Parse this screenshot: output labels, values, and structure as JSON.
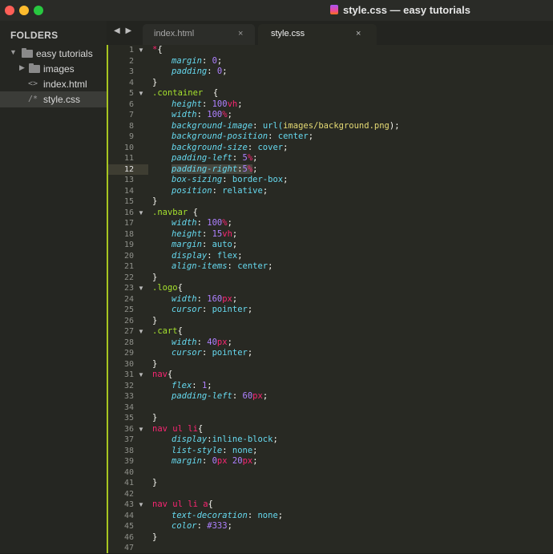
{
  "window": {
    "title": "style.css — easy tutorials"
  },
  "sidebar": {
    "header": "FOLDERS",
    "root": "easy tutorials",
    "items": [
      {
        "label": "images",
        "icon": "folder-icon"
      },
      {
        "label": "index.html",
        "icon": "html-file-icon"
      },
      {
        "label": "style.css",
        "icon": "css-file-icon"
      }
    ]
  },
  "tabs": [
    {
      "label": "index.html",
      "close": "×"
    },
    {
      "label": "style.css",
      "close": "×"
    }
  ],
  "nav_arrows": "◀ ▶",
  "editor": {
    "current_line": 12,
    "lines": [
      {
        "n": "1"
      },
      {
        "n": "2"
      },
      {
        "n": "3"
      },
      {
        "n": "4"
      },
      {
        "n": "5"
      },
      {
        "n": "6"
      },
      {
        "n": "7"
      },
      {
        "n": "8"
      },
      {
        "n": "9"
      },
      {
        "n": "10"
      },
      {
        "n": "11"
      },
      {
        "n": "12"
      },
      {
        "n": "13"
      },
      {
        "n": "14"
      },
      {
        "n": "15"
      },
      {
        "n": "16"
      },
      {
        "n": "17"
      },
      {
        "n": "18"
      },
      {
        "n": "19"
      },
      {
        "n": "20"
      },
      {
        "n": "21"
      },
      {
        "n": "22"
      },
      {
        "n": "23"
      },
      {
        "n": "24"
      },
      {
        "n": "25"
      },
      {
        "n": "26"
      },
      {
        "n": "27"
      },
      {
        "n": "28"
      },
      {
        "n": "29"
      },
      {
        "n": "30"
      },
      {
        "n": "31"
      },
      {
        "n": "32"
      },
      {
        "n": "33"
      },
      {
        "n": "34"
      },
      {
        "n": "35"
      },
      {
        "n": "36"
      },
      {
        "n": "37"
      },
      {
        "n": "38"
      },
      {
        "n": "39"
      },
      {
        "n": "40"
      },
      {
        "n": "41"
      },
      {
        "n": "42"
      },
      {
        "n": "43"
      },
      {
        "n": "44"
      },
      {
        "n": "45"
      },
      {
        "n": "46"
      },
      {
        "n": "47"
      }
    ],
    "code": {
      "l1_sel": "*",
      "l1_brace": "{",
      "l2_prop": "margin",
      "l2_num": "0",
      "l3_prop": "padding",
      "l3_num": "0",
      "l4": "}",
      "l5_sel": ".container",
      "l5_brace": "  {",
      "l6_prop": "height",
      "l6_num": "100",
      "l6_unit": "vh",
      "l7_prop": "width",
      "l7_num": "100",
      "l7_unit": "%",
      "l8_prop": "background-image",
      "l8_fn": "url(",
      "l8_str": "images/background.png",
      "l8_end": ");",
      "l9_prop": "background-position",
      "l9_val": "center",
      "l10_prop": "background-size",
      "l10_val": "cover",
      "l11_prop": "padding-left",
      "l11_num": "5",
      "l11_unit": "%",
      "l12_prop": "padding-right",
      "l12_num": "5",
      "l12_unit": "%",
      "l13_prop": "box-sizing",
      "l13_val": "border-box",
      "l14_prop": "position",
      "l14_val": "relative",
      "l15": "}",
      "l16_sel": ".navbar",
      "l16_brace": " {",
      "l17_prop": "width",
      "l17_num": "100",
      "l17_unit": "%",
      "l18_prop": "height",
      "l18_num": "15",
      "l18_unit": "vh",
      "l19_prop": "margin",
      "l19_val": "auto",
      "l20_prop": "display",
      "l20_val": "flex",
      "l21_prop": "align-items",
      "l21_val": "center",
      "l22": "}",
      "l23_sel": ".logo",
      "l23_brace": "{",
      "l24_prop": "width",
      "l24_num": "160",
      "l24_unit": "px",
      "l25_prop": "cursor",
      "l25_val": "pointer",
      "l26": "}",
      "l27_sel": ".cart",
      "l27_brace": "{",
      "l28_prop": "width",
      "l28_num": "40",
      "l28_unit": "px",
      "l29_prop": "cursor",
      "l29_val": "pointer",
      "l30": "}",
      "l31_sel": "nav",
      "l31_brace": "{",
      "l32_prop": "flex",
      "l32_num": "1",
      "l33_prop": "padding-left",
      "l33_num": "60",
      "l33_unit": "px",
      "l35": "}",
      "l36_sel": "nav ul li",
      "l36_brace": "{",
      "l37_prop": "display",
      "l37_val": "inline-block",
      "l38_prop": "list-style",
      "l38_val": "none",
      "l39_prop": "margin",
      "l39_num1": "0",
      "l39_unit1": "px",
      "l39_num2": "20",
      "l39_unit2": "px",
      "l41": "}",
      "l43_sel": "nav ul li a",
      "l43_brace": "{",
      "l44_prop": "text-decoration",
      "l44_val": "none",
      "l45_prop": "color",
      "l45_val": "#333",
      "l46": "}"
    }
  },
  "colors": {
    "accent_gutter": "#a7c520",
    "keyword": "#f92672",
    "class": "#a6e22e",
    "property": "#66d9ef",
    "number": "#ae81ff",
    "string": "#e6db74"
  }
}
